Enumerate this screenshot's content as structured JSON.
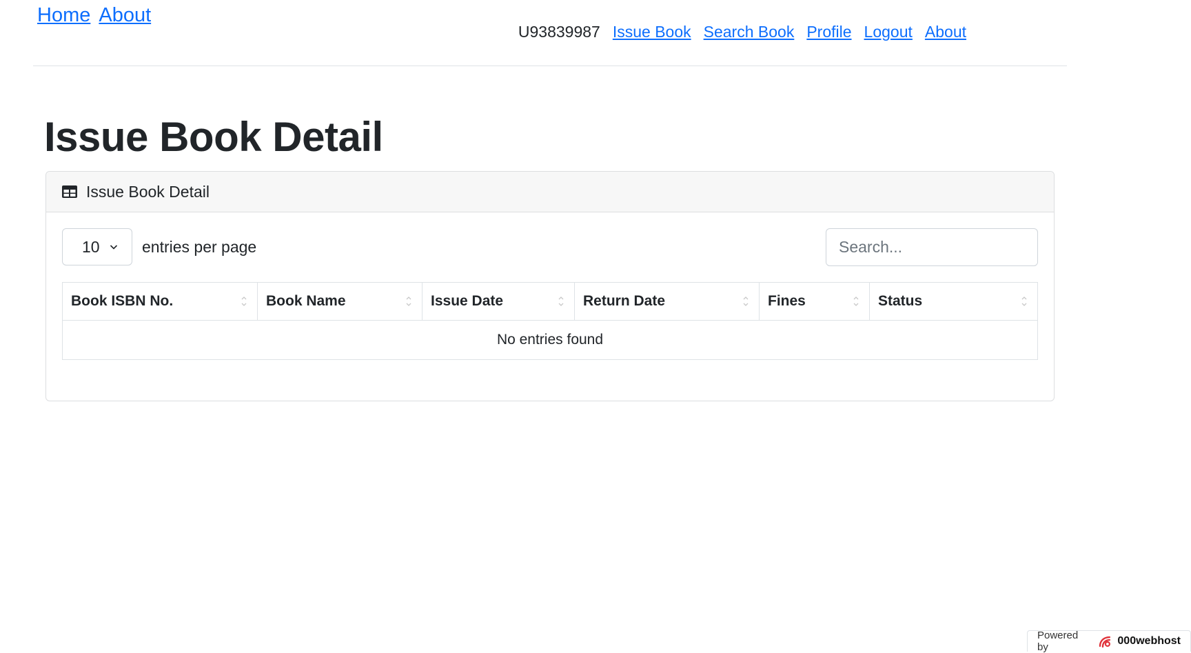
{
  "top_nav_left": {
    "home": "Home",
    "about": "About"
  },
  "top_nav_right": {
    "user_id": "U93839987",
    "issue_book": "Issue Book",
    "search_book": "Search Book",
    "profile": "Profile",
    "logout": "Logout",
    "about": "About"
  },
  "page": {
    "title": "Issue Book Detail"
  },
  "card": {
    "header_title": "Issue Book Detail",
    "header_icon": "table-icon",
    "entries_value": "10",
    "entries_label": "entries per page",
    "search_placeholder": "Search...",
    "columns": [
      "Book ISBN No.",
      "Book Name",
      "Issue Date",
      "Return Date",
      "Fines",
      "Status"
    ],
    "empty_message": "No entries found"
  },
  "footer": {
    "powered_by": "Powered by",
    "brand": "000webhost"
  },
  "colors": {
    "link": "#0d6efd",
    "text": "#212529",
    "border": "#dee2e6",
    "header_bg": "#f7f7f7"
  }
}
